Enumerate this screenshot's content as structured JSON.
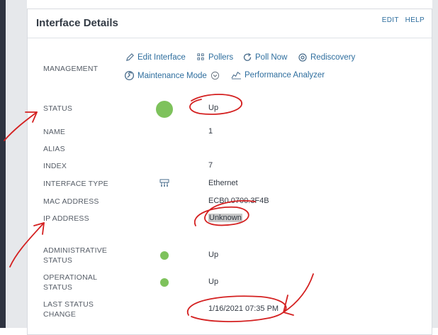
{
  "panel": {
    "title": "Interface Details",
    "edit_label": "EDIT",
    "help_label": "HELP"
  },
  "management": {
    "label": "MANAGEMENT",
    "links": {
      "edit_interface": "Edit Interface",
      "pollers": "Pollers",
      "poll_now": "Poll Now",
      "rediscovery": "Rediscovery",
      "maintenance_mode": "Maintenance Mode",
      "performance_analyzer": "Performance Analyzer"
    }
  },
  "details": {
    "status": {
      "label": "STATUS",
      "value": "Up"
    },
    "name": {
      "label": "NAME",
      "value": "1"
    },
    "alias": {
      "label": "ALIAS",
      "value": ""
    },
    "index": {
      "label": "INDEX",
      "value": "7"
    },
    "interface_type": {
      "label": "INTERFACE TYPE",
      "value": "Ethernet"
    },
    "mac_address": {
      "label": "MAC ADDRESS",
      "value": "ECB0.0700.3F4B"
    },
    "ip_address": {
      "label": "IP ADDRESS",
      "value": "Unknown"
    },
    "administrative_status": {
      "label_line1": "ADMINISTRATIVE",
      "label_line2": "STATUS",
      "value": "Up"
    },
    "operational_status": {
      "label_line1": "OPERATIONAL",
      "label_line2": "STATUS",
      "value": "Up"
    },
    "last_status_change": {
      "label_line1": "LAST STATUS",
      "label_line2": "CHANGE",
      "value": "1/16/2021 07:35 PM"
    }
  },
  "colors": {
    "status_up": "#7ec25c",
    "link": "#2e6e9e",
    "annotation": "#d42020"
  },
  "icons": {
    "edit": "pencil-icon",
    "pollers": "pollers-icon",
    "poll_now": "refresh-icon",
    "rediscovery": "rediscovery-icon",
    "maintenance": "maintenance-icon",
    "performance": "performance-analyzer-icon",
    "interface_type": "network-interface-icon"
  }
}
